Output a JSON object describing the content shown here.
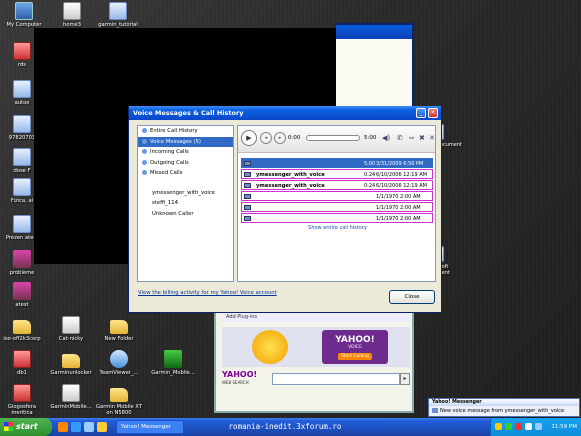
{
  "desktop_icons": [
    {
      "label": "My Computer",
      "kind": "pc"
    },
    {
      "label": "home3",
      "kind": "jpg"
    },
    {
      "label": "garmin_tutorial",
      "kind": "doc"
    },
    {
      "label": "rds",
      "kind": "exe"
    },
    {
      "label": "autoe",
      "kind": "doc"
    },
    {
      "label": "97820703",
      "kind": "doc"
    },
    {
      "label": "dose F",
      "kind": "doc"
    },
    {
      "label": "Fizica, ai",
      "kind": "doc"
    },
    {
      "label": "Prezen atest",
      "kind": "doc"
    },
    {
      "label": "probleme",
      "kind": "rar"
    },
    {
      "label": "atest",
      "kind": "rar"
    },
    {
      "label": "iso-off2k3corp",
      "kind": "folder"
    },
    {
      "label": "Cat-nicky",
      "kind": "jpg"
    },
    {
      "label": "New Folder",
      "kind": "folder"
    },
    {
      "label": "db1",
      "kind": "exe"
    },
    {
      "label": "Garminunlocker",
      "kind": "folder"
    },
    {
      "label": "TeamViewer_...",
      "kind": "tv"
    },
    {
      "label": "Garmin_Mobile...",
      "kind": "garmin"
    },
    {
      "label": "Glogosfera meritica",
      "kind": "exe"
    },
    {
      "label": "GarminMobile...",
      "kind": "jpg"
    },
    {
      "label": "Garmin Mobile XT on N5800",
      "kind": "folder"
    }
  ],
  "right_desktop": {
    "rich_text": "Rich Text Document",
    "microsoft": "Microsoft Document"
  },
  "dialog": {
    "title": "Voice Messages & Call History",
    "nav": [
      {
        "label": "Entire Call History",
        "selected": false
      },
      {
        "label": "Voice Messages (5)",
        "selected": true
      },
      {
        "label": "Incoming Calls",
        "selected": false
      },
      {
        "label": "Outgoing Calls",
        "selected": false
      },
      {
        "label": "Missed Calls",
        "selected": false
      }
    ],
    "contacts": [
      "ymessenger_with_voice",
      "steffi_114",
      "Unknown Caller"
    ],
    "player": {
      "time_current": "0:00",
      "time_total": "5:00"
    },
    "messages": [
      {
        "name": "",
        "duration": "5:00",
        "date": "3/31/2009 6:50 PM",
        "selected": true
      },
      {
        "name": "ymessenger_with_voice",
        "duration": "0:24",
        "date": "6/10/2006 12:19 AM",
        "selected": false
      },
      {
        "name": "ymessenger_with_voice",
        "duration": "0:24",
        "date": "6/10/2006 12:19 AM",
        "selected": false
      },
      {
        "name": "",
        "duration": "",
        "date": "1/1/1970 2:00 AM",
        "selected": false
      },
      {
        "name": "",
        "duration": "",
        "date": "1/1/1970 2:00 AM",
        "selected": false
      },
      {
        "name": "",
        "duration": "",
        "date": "1/1/1970 2:00 AM",
        "selected": false
      }
    ],
    "show_all_link": "Show entire call history",
    "billing_link": "View the billing activity for my Yahoo! Voice account",
    "close_label": "Close"
  },
  "yahoo_window": {
    "plugins_label": "Add Plug-ins",
    "ad_brand": "YAHOO!",
    "ad_sub": "VOICE",
    "ad_button": "Start Calling",
    "search_logo": "YAHOO!",
    "search_sub": "WEB SEARCH"
  },
  "taskbar": {
    "start_label": "start",
    "task_label": "Yahoo! Messenger",
    "center_text": "romania-inedit.3xforum.ro",
    "clock": "11:59 PM"
  },
  "balloon": {
    "title": "Yahoo! Messenger",
    "text": "New voice message from ymessenger_with_voice"
  }
}
